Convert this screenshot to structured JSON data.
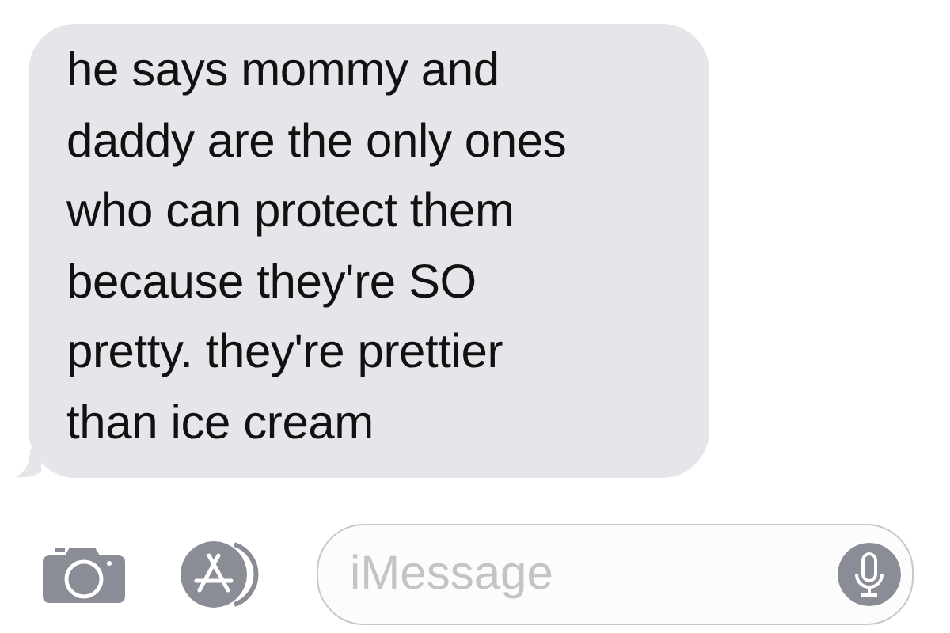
{
  "message": {
    "text": "he says mommy and\ndaddy are the only ones\nwho can protect them\nbecause they're SO\npretty. they're prettier\nthan ice cream"
  },
  "compose": {
    "placeholder": "iMessage"
  }
}
